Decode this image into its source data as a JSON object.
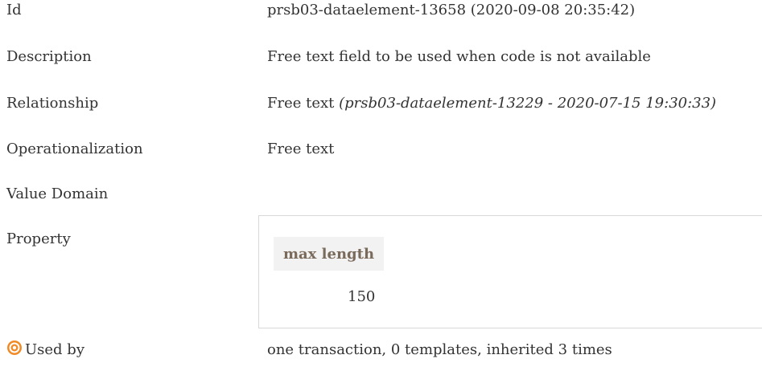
{
  "rows": {
    "id": {
      "label": "Id",
      "value": "prsb03-dataelement-13658 (2020-09-08 20:35:42)"
    },
    "description": {
      "label": "Description",
      "value": "Free text field to be used when code is not available"
    },
    "relationship": {
      "label": "Relationship",
      "value_text": "Free text",
      "value_ref": "(prsb03-dataelement-13229 - 2020-07-15 19:30:33)"
    },
    "operationalization": {
      "label": "Operationalization",
      "value": "Free text"
    },
    "value_domain": {
      "label": "Value Domain"
    },
    "property": {
      "label": "Property",
      "header": "max length",
      "value": "150"
    },
    "used_by": {
      "label": "Used by",
      "value": "one transaction, 0 templates, inherited 3 times",
      "icon": "target-icon",
      "icon_color": "#f08a24"
    }
  }
}
